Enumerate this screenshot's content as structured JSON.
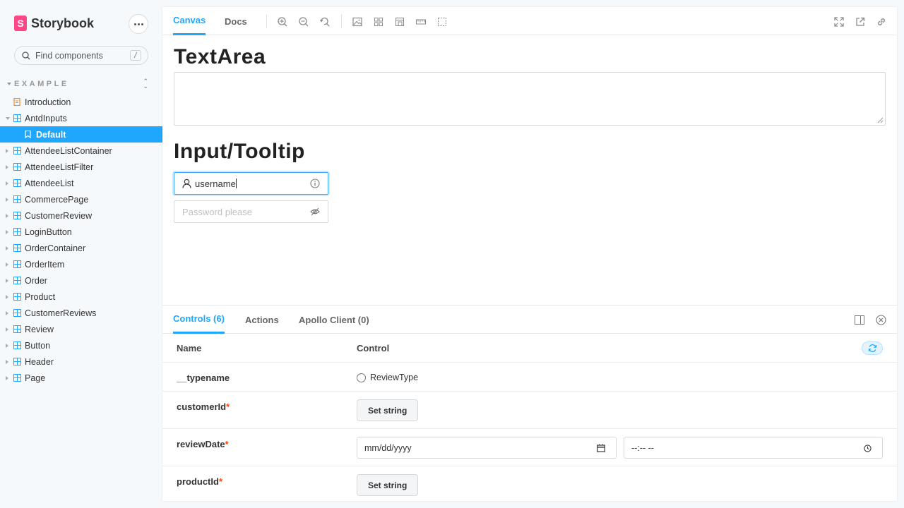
{
  "brand": {
    "name": "Storybook",
    "logo_letter": "S"
  },
  "search": {
    "placeholder": "Find components",
    "shortcut": "/"
  },
  "sidebar": {
    "group_label": "EXAMPLE",
    "items": [
      {
        "label": "Introduction",
        "type": "doc"
      },
      {
        "label": "AntdInputs",
        "type": "component",
        "expanded": true
      },
      {
        "label": "Default",
        "type": "story",
        "selected": true
      },
      {
        "label": "AttendeeListContainer",
        "type": "component"
      },
      {
        "label": "AttendeeListFilter",
        "type": "component"
      },
      {
        "label": "AttendeeList",
        "type": "component"
      },
      {
        "label": "CommercePage",
        "type": "component"
      },
      {
        "label": "CustomerReview",
        "type": "component"
      },
      {
        "label": "LoginButton",
        "type": "component"
      },
      {
        "label": "OrderContainer",
        "type": "component"
      },
      {
        "label": "OrderItem",
        "type": "component"
      },
      {
        "label": "Order",
        "type": "component"
      },
      {
        "label": "Product",
        "type": "component"
      },
      {
        "label": "CustomerReviews",
        "type": "component"
      },
      {
        "label": "Review",
        "type": "component"
      },
      {
        "label": "Button",
        "type": "component"
      },
      {
        "label": "Header",
        "type": "component"
      },
      {
        "label": "Page",
        "type": "component"
      }
    ]
  },
  "toolbar": {
    "tabs": [
      "Canvas",
      "Docs"
    ],
    "active_tab": "Canvas"
  },
  "canvas": {
    "heading_textarea": "TextArea",
    "heading_input": "Input/Tooltip",
    "username_value": "username",
    "password_placeholder": "Password please"
  },
  "addons": {
    "tabs": [
      "Controls (6)",
      "Actions",
      "Apollo Client (0)"
    ],
    "active_tab": "Controls (6)",
    "columns": {
      "name": "Name",
      "control": "Control"
    },
    "rows": [
      {
        "name": "__typename",
        "required": false,
        "control": "ReviewType"
      },
      {
        "name": "customerId",
        "required": true,
        "control": "Set string"
      },
      {
        "name": "reviewDate",
        "required": true,
        "date": "mm/dd/yyyy",
        "time": "--:-- --"
      },
      {
        "name": "productId",
        "required": true,
        "control": "Set string"
      }
    ],
    "required_mark": "*"
  },
  "colors": {
    "accent": "#1ea7fd",
    "brand": "#ff4785",
    "required": "#ff4400"
  }
}
